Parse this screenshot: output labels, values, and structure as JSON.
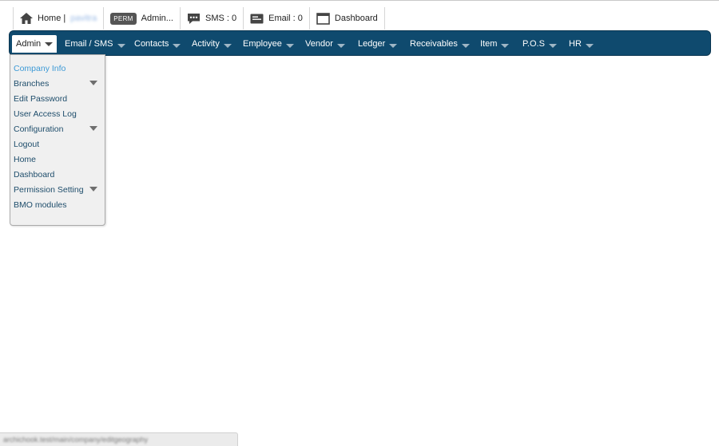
{
  "topbar": {
    "home_label": "Home |",
    "home_user": "pavitra",
    "perm_badge": "PERM",
    "admin_label": "Admin...",
    "sms_label": "SMS : 0",
    "email_label": "Email : 0",
    "dashboard_label": "Dashboard"
  },
  "nav": {
    "items": [
      {
        "label": "Admin"
      },
      {
        "label": "Email / SMS"
      },
      {
        "label": "Contacts"
      },
      {
        "label": "Activity"
      },
      {
        "label": "Employee"
      },
      {
        "label": "Vendor"
      },
      {
        "label": "Ledger"
      },
      {
        "label": "Receivables"
      },
      {
        "label": "Item"
      },
      {
        "label": "P.O.S"
      },
      {
        "label": "HR"
      }
    ]
  },
  "dropdown": {
    "items": [
      {
        "label": "Company Info"
      },
      {
        "label": "Branches"
      },
      {
        "label": "Edit Password"
      },
      {
        "label": "User Access Log"
      },
      {
        "label": "Configuration"
      },
      {
        "label": "Logout"
      },
      {
        "label": "Home"
      },
      {
        "label": "Dashboard"
      },
      {
        "label": "Permission Setting"
      },
      {
        "label": "BMO modules"
      }
    ]
  },
  "statusbar": {
    "url": "archichook.test/main/company/editgeography"
  },
  "colors": {
    "nav_background": "#0f4a6e",
    "dropdown_background": "#f0f0f0",
    "dropdown_text": "#1e4d6b",
    "selected_text": "#3d9ad6"
  }
}
